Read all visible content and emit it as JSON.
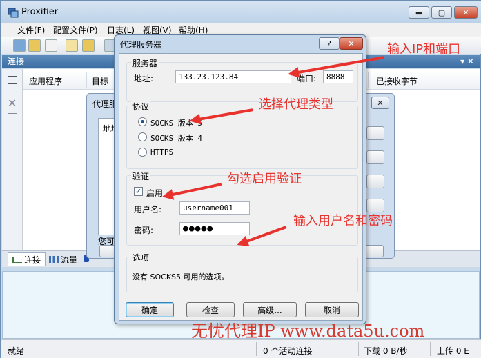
{
  "app": {
    "title": "Proxifier",
    "window_controls": {
      "minimize": "▬",
      "maximize": "▢",
      "close": "✕"
    }
  },
  "menu": [
    "文件(F)",
    "配置文件(P)",
    "日志(L)",
    "视图(V)",
    "帮助(H)"
  ],
  "connections": {
    "header": "连接",
    "header_controls": "▾ ✕",
    "columns": [
      "应用程序",
      "目标",
      "已接收字节"
    ],
    "tabs": [
      "连接",
      "流量"
    ]
  },
  "bg_dialog": {
    "title": "代理服",
    "inner_label": "地址",
    "footer_text": "您可"
  },
  "dialog": {
    "title": "代理服务器",
    "help_button": "?",
    "close_button": "✕",
    "server": {
      "group_title": "服务器",
      "address_label": "地址:",
      "address_value": "133.23.123.84",
      "port_label": "端口:",
      "port_value": "8888"
    },
    "protocol": {
      "group_title": "协议",
      "options": [
        "SOCKS 版本 5",
        "SOCKS 版本 4",
        "HTTPS"
      ],
      "selected": 0
    },
    "auth": {
      "group_title": "验证",
      "enable_label": "启用",
      "enabled": true,
      "username_label": "用户名:",
      "username_value": "username001",
      "password_label": "密码:",
      "password_value": "●●●●●"
    },
    "options": {
      "group_title": "选项",
      "text": "没有 SOCKS5 可用的选项。"
    },
    "buttons": {
      "ok": "确定",
      "check": "检查",
      "advanced": "高级...",
      "cancel": "取消"
    }
  },
  "annotations": {
    "ip_port": "输入IP和端口",
    "proxy_type": "选择代理类型",
    "auth_check": "勾选启用验证",
    "credentials": "输入用户名和密码",
    "color": "#e8322d"
  },
  "watermark": "无忧代理IP  www.data5u.com",
  "status": {
    "ready": "就绪",
    "active": "0 个活动连接",
    "download": "下载 0 B/秒",
    "upload": "上传 0 E"
  }
}
